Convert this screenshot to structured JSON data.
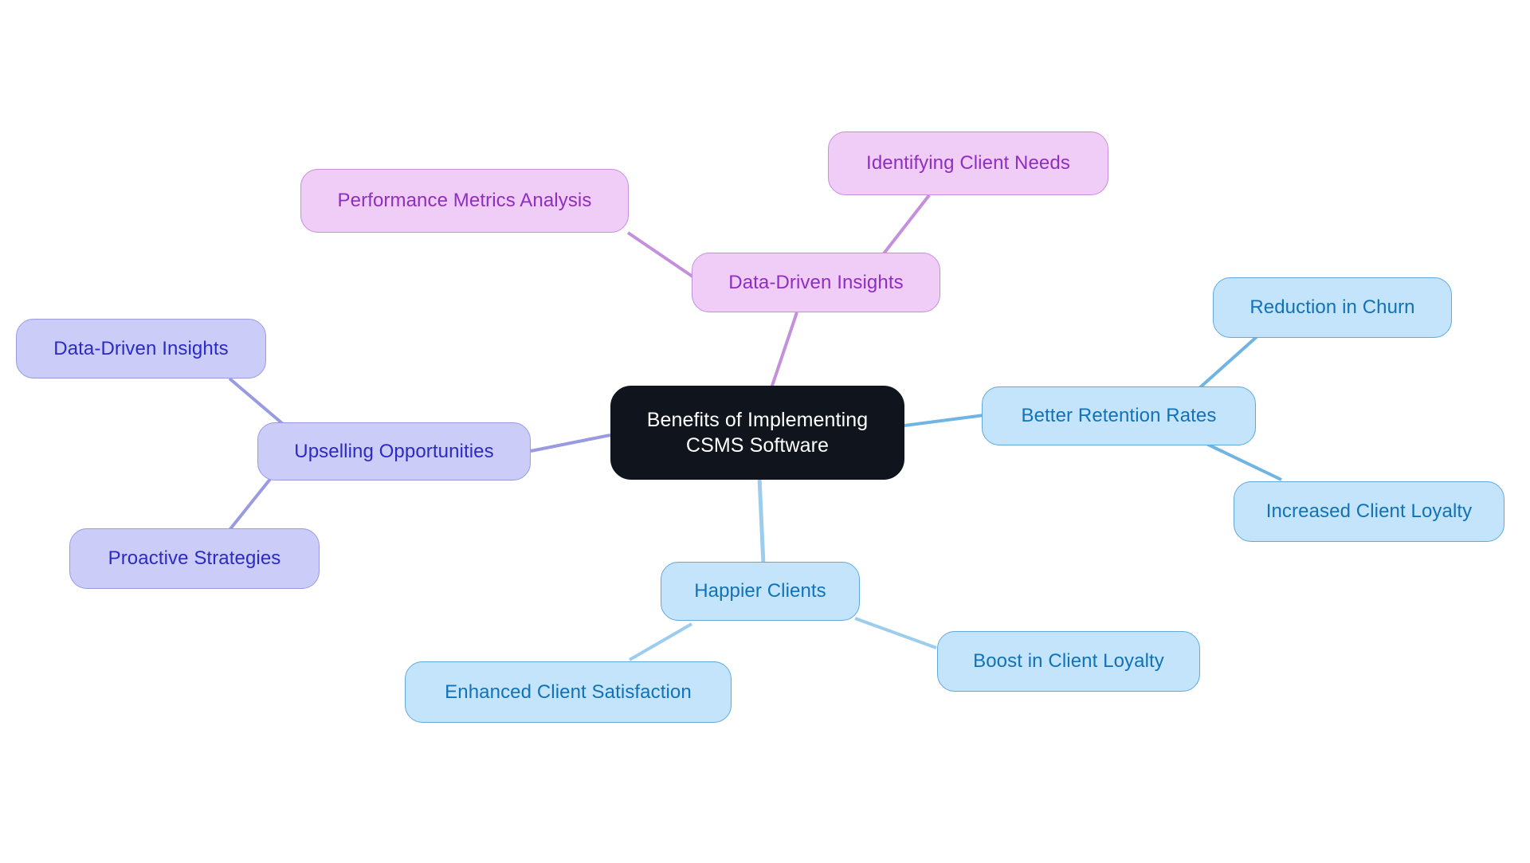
{
  "diagram": {
    "type": "mindmap",
    "title": "Benefits of Implementing CSMS Software",
    "background_color": "#ffffff",
    "root": {
      "id": "root",
      "label": "Benefits of Implementing CSMS Software",
      "label_line1": "Benefits of Implementing",
      "label_line2": "CSMS Software",
      "fill": "#10141c",
      "text_color": "#ffffff"
    },
    "branches": [
      {
        "id": "data-driven-insights-violet",
        "label": "Data-Driven Insights",
        "color_name": "violet",
        "fill": "#efcdf7",
        "border": "#c48fdc",
        "text_color": "#8f2ec0",
        "children": [
          {
            "id": "performance-metrics-analysis",
            "label": "Performance Metrics Analysis"
          },
          {
            "id": "identifying-client-needs",
            "label": "Identifying Client Needs"
          }
        ]
      },
      {
        "id": "upselling-opportunities",
        "label": "Upselling Opportunities",
        "color_name": "periwinkle",
        "fill": "#ccccf9",
        "border": "#9a9ae2",
        "text_color": "#2b2bc4",
        "children": [
          {
            "id": "data-driven-insights-periwinkle",
            "label": "Data-Driven Insights"
          },
          {
            "id": "proactive-strategies",
            "label": "Proactive Strategies"
          }
        ]
      },
      {
        "id": "better-retention-rates",
        "label": "Better Retention Rates",
        "color_name": "blue",
        "fill": "#c3e4fb",
        "border": "#5fa9df",
        "text_color": "#1272b8",
        "children": [
          {
            "id": "reduction-in-churn",
            "label": "Reduction in Churn"
          },
          {
            "id": "increased-client-loyalty",
            "label": "Increased Client Loyalty"
          }
        ]
      },
      {
        "id": "happier-clients",
        "label": "Happier Clients",
        "color_name": "blue",
        "fill": "#c3e4fb",
        "border": "#5fa9df",
        "text_color": "#1272b8",
        "children": [
          {
            "id": "enhanced-client-satisfaction",
            "label": "Enhanced Client Satisfaction"
          },
          {
            "id": "boost-in-client-loyalty",
            "label": "Boost in Client Loyalty"
          }
        ]
      }
    ],
    "edges": [
      {
        "from": "root",
        "to": "data-driven-insights-violet",
        "stroke": "#c48fdc"
      },
      {
        "from": "data-driven-insights-violet",
        "to": "performance-metrics-analysis",
        "stroke": "#c48fdc"
      },
      {
        "from": "data-driven-insights-violet",
        "to": "identifying-client-needs",
        "stroke": "#c48fdc"
      },
      {
        "from": "root",
        "to": "upselling-opportunities",
        "stroke": "#9a9ae2"
      },
      {
        "from": "upselling-opportunities",
        "to": "data-driven-insights-periwinkle",
        "stroke": "#9a9ae2"
      },
      {
        "from": "upselling-opportunities",
        "to": "proactive-strategies",
        "stroke": "#9a9ae2"
      },
      {
        "from": "root",
        "to": "better-retention-rates",
        "stroke": "#5fa9df"
      },
      {
        "from": "better-retention-rates",
        "to": "reduction-in-churn",
        "stroke": "#5fa9df"
      },
      {
        "from": "better-retention-rates",
        "to": "increased-client-loyalty",
        "stroke": "#5fa9df"
      },
      {
        "from": "root",
        "to": "happier-clients",
        "stroke": "#8cc6ea"
      },
      {
        "from": "happier-clients",
        "to": "enhanced-client-satisfaction",
        "stroke": "#8cc6ea"
      },
      {
        "from": "happier-clients",
        "to": "boost-in-client-loyalty",
        "stroke": "#8cc6ea"
      }
    ]
  }
}
